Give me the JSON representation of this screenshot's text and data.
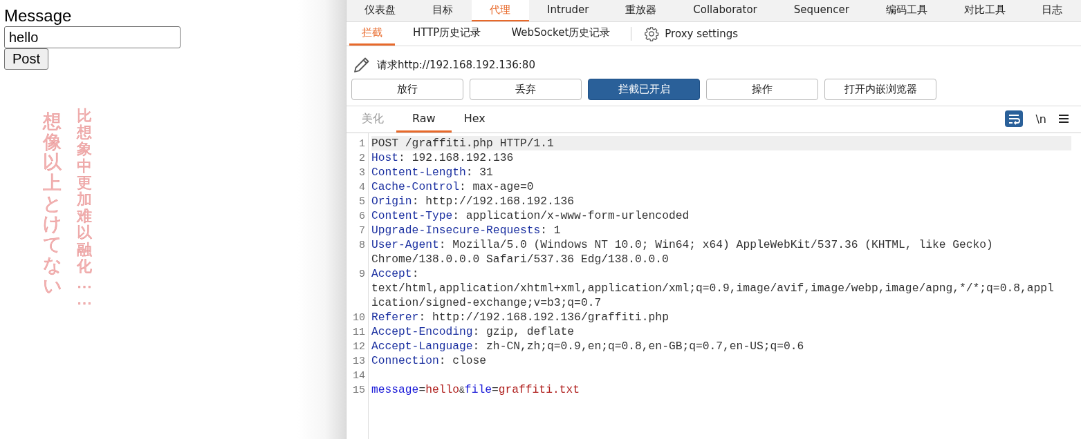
{
  "form": {
    "label": "Message",
    "value": "hello",
    "button": "Post"
  },
  "lyrics": [
    "想像以上とけてない",
    "比想象中更加难以融化……"
  ],
  "main_tabs": [
    {
      "label": "仪表盘",
      "selected": false
    },
    {
      "label": "目标",
      "selected": false
    },
    {
      "label": "代理",
      "selected": true
    },
    {
      "label": "Intruder",
      "selected": false
    },
    {
      "label": "重放器",
      "selected": false
    },
    {
      "label": "Collaborator",
      "selected": false
    },
    {
      "label": "Sequencer",
      "selected": false
    },
    {
      "label": "编码工具",
      "selected": false
    },
    {
      "label": "对比工具",
      "selected": false
    },
    {
      "label": "日志",
      "selected": false
    }
  ],
  "sub_tabs": [
    {
      "label": "拦截",
      "selected": true
    },
    {
      "label": "HTTP历史记录",
      "selected": false
    },
    {
      "label": "WebSocket历史记录",
      "selected": false
    }
  ],
  "settings_link": "Proxy settings",
  "request_title": "请求http://192.168.192.136:80",
  "actions": [
    {
      "label": "放行",
      "pressed": false
    },
    {
      "label": "丢弃",
      "pressed": false
    },
    {
      "label": "拦截已开启",
      "pressed": true
    },
    {
      "label": "操作",
      "pressed": false
    },
    {
      "label": "打开内嵌浏览器",
      "pressed": false
    }
  ],
  "view_tabs": [
    {
      "label": "美化",
      "selected": false,
      "disabled": true
    },
    {
      "label": "Raw",
      "selected": true,
      "disabled": false
    },
    {
      "label": "Hex",
      "selected": false,
      "disabled": false
    }
  ],
  "newline_toggle": "\\n",
  "editor_lines": [
    {
      "number": "1",
      "selected": true,
      "segments": [
        {
          "kind": "plain",
          "text": "POST /graffiti.php HTTP/1.1"
        }
      ]
    },
    {
      "number": "2",
      "selected": false,
      "segments": [
        {
          "kind": "name",
          "text": "Host"
        },
        {
          "kind": "plain",
          "text": ": 192.168.192.136"
        }
      ]
    },
    {
      "number": "3",
      "selected": false,
      "segments": [
        {
          "kind": "name",
          "text": "Content-Length"
        },
        {
          "kind": "plain",
          "text": ": 31"
        }
      ]
    },
    {
      "number": "4",
      "selected": false,
      "segments": [
        {
          "kind": "name",
          "text": "Cache-Control"
        },
        {
          "kind": "plain",
          "text": ": max-age=0"
        }
      ]
    },
    {
      "number": "5",
      "selected": false,
      "segments": [
        {
          "kind": "name",
          "text": "Origin"
        },
        {
          "kind": "plain",
          "text": ": http://192.168.192.136"
        }
      ]
    },
    {
      "number": "6",
      "selected": false,
      "segments": [
        {
          "kind": "name",
          "text": "Content-Type"
        },
        {
          "kind": "plain",
          "text": ": application/x-www-form-urlencoded"
        }
      ]
    },
    {
      "number": "7",
      "selected": false,
      "segments": [
        {
          "kind": "name",
          "text": "Upgrade-Insecure-Requests"
        },
        {
          "kind": "plain",
          "text": ": 1"
        }
      ]
    },
    {
      "number": "8",
      "selected": false,
      "segments": [
        {
          "kind": "name",
          "text": "User-Agent"
        },
        {
          "kind": "plain",
          "text": ": Mozilla/5.0 (Windows NT 10.0; Win64; x64) AppleWebKit/537.36 (KHTML, like Gecko)"
        }
      ]
    },
    {
      "selected": false,
      "segments": [
        {
          "kind": "plain",
          "text": "Chrome/138.0.0.0 Safari/537.36 Edg/138.0.0.0"
        }
      ]
    },
    {
      "number": "9",
      "selected": false,
      "segments": [
        {
          "kind": "name",
          "text": "Accept"
        },
        {
          "kind": "plain",
          "text": ":"
        }
      ]
    },
    {
      "selected": false,
      "segments": [
        {
          "kind": "plain",
          "text": "text/html,application/xhtml+xml,application/xml;q=0.9,image/avif,image/webp,image/apng,*/*;q=0.8,appl"
        }
      ]
    },
    {
      "selected": false,
      "segments": [
        {
          "kind": "plain",
          "text": "ication/signed-exchange;v=b3;q=0.7"
        }
      ]
    },
    {
      "number": "10",
      "selected": false,
      "segments": [
        {
          "kind": "name",
          "text": "Referer"
        },
        {
          "kind": "plain",
          "text": ": http://192.168.192.136/graffiti.php"
        }
      ]
    },
    {
      "number": "11",
      "selected": false,
      "segments": [
        {
          "kind": "name",
          "text": "Accept-Encoding"
        },
        {
          "kind": "plain",
          "text": ": gzip, deflate"
        }
      ]
    },
    {
      "number": "12",
      "selected": false,
      "segments": [
        {
          "kind": "name",
          "text": "Accept-Language"
        },
        {
          "kind": "plain",
          "text": ": zh-CN,zh;q=0.9,en;q=0.8,en-GB;q=0.7,en-US;q=0.6"
        }
      ]
    },
    {
      "number": "13",
      "selected": false,
      "segments": [
        {
          "kind": "name",
          "text": "Connection"
        },
        {
          "kind": "plain",
          "text": ": close"
        }
      ]
    },
    {
      "number": "14",
      "selected": false
    },
    {
      "number": "15",
      "selected": false,
      "segments": [
        {
          "kind": "param",
          "text": "message"
        },
        {
          "kind": "plain",
          "text": "="
        },
        {
          "kind": "value",
          "text": "hello"
        },
        {
          "kind": "amp",
          "text": "&"
        },
        {
          "kind": "param",
          "text": "file"
        },
        {
          "kind": "plain",
          "text": "="
        },
        {
          "kind": "value",
          "text": "graffiti.txt"
        }
      ]
    }
  ]
}
